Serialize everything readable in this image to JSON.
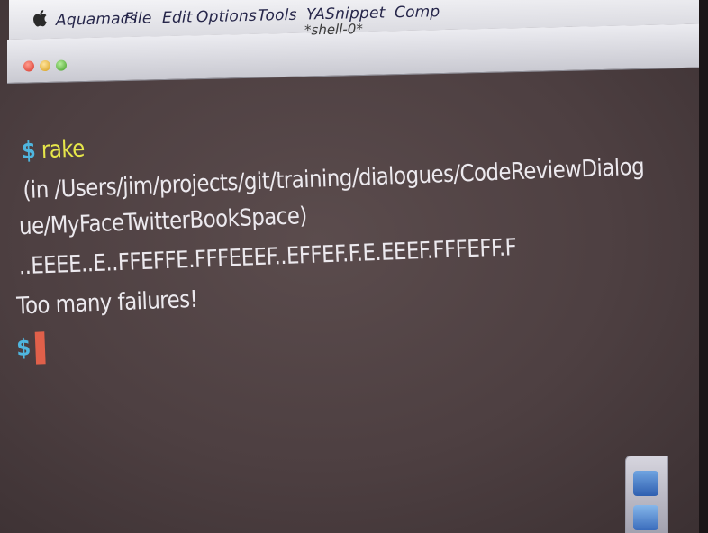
{
  "menubar": {
    "apple_icon": "apple-logo",
    "items": [
      "Aquamacs",
      "File",
      "Edit",
      "Options",
      "Tools",
      "YASnippet",
      "Comp"
    ]
  },
  "window": {
    "title": "*shell-0*",
    "traffic_lights": {
      "close": "#d6342a",
      "minimize": "#d49b18",
      "zoom": "#3f9b24"
    }
  },
  "terminal": {
    "prompt": "$",
    "command": "rake",
    "path_line_1": "(in /Users/jim/projects/git/training/dialogues/CodeReviewDialog",
    "path_line_2": "ue/MyFaceTwitterBookSpace)",
    "results": "..EEEE..E..FFEFFE.FFFEEEF..EFFEF.F.E.EEEF.FFFEFF.F",
    "message": "Too many failures!",
    "colors": {
      "prompt": "#4fb6df",
      "command": "#e6e64a",
      "cursor": "#e0604a",
      "text": "#ece9ee"
    }
  },
  "dock": {
    "icons": [
      "finder-icon",
      "app-icon"
    ]
  }
}
